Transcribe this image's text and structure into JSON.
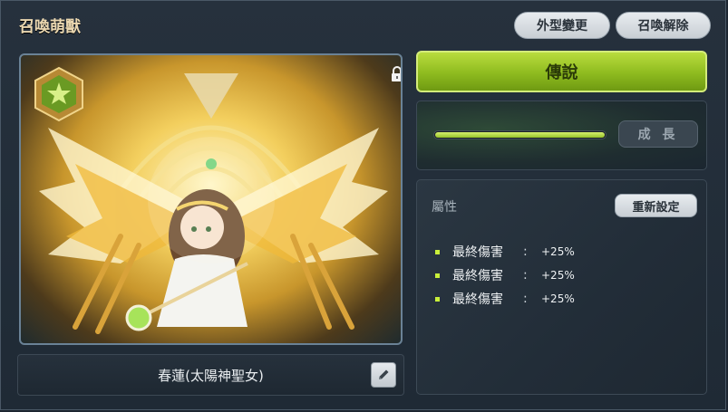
{
  "window": {
    "title": "召喚萌獸"
  },
  "header_buttons": {
    "appearance": "外型變更",
    "release": "召喚解除"
  },
  "pet": {
    "name": "春蓮(太陽神聖女)",
    "grade": "傳說",
    "growth_progress": 1.0,
    "grow_label": "成 長"
  },
  "attributes": {
    "label": "屬性",
    "reset_label": "重新設定",
    "items": [
      {
        "name": "最終傷害",
        "sep": ":",
        "value": "+25%"
      },
      {
        "name": "最終傷害",
        "sep": ":",
        "value": "+25%"
      },
      {
        "name": "最終傷害",
        "sep": ":",
        "value": "+25%"
      }
    ]
  },
  "icons": [
    "star-icon",
    "lock-icon",
    "pencil-icon"
  ],
  "colors": {
    "legend_green": "#9bc72a",
    "title_gold": "#ead7b0",
    "bullet_green": "#c9f03a"
  }
}
